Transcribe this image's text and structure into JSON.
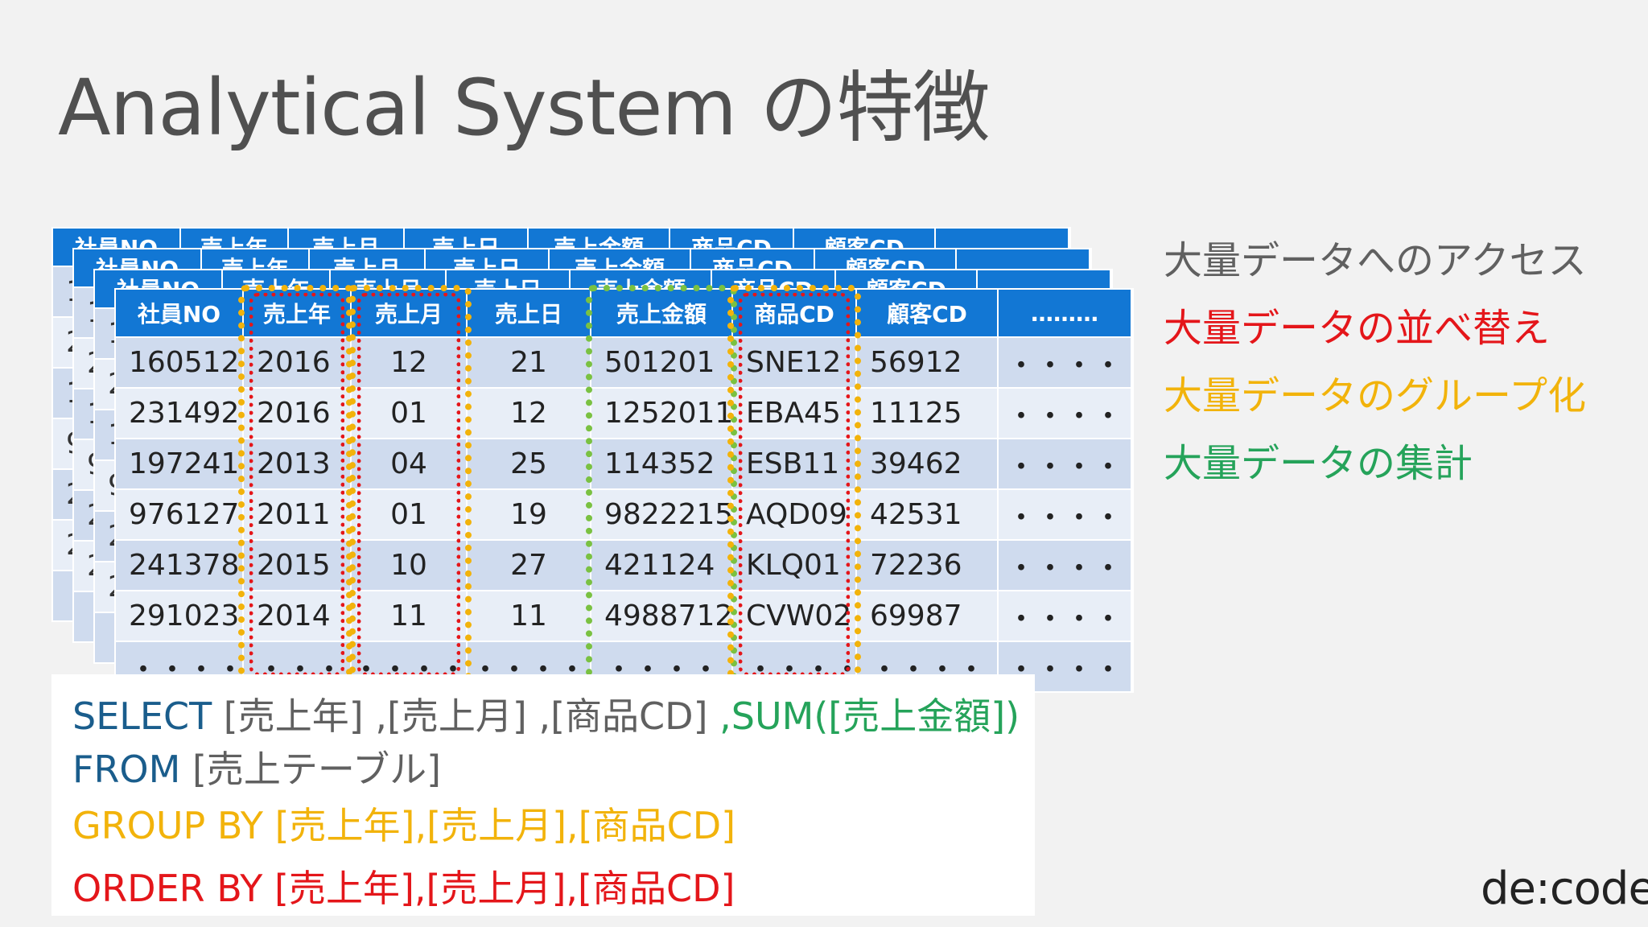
{
  "title": "Analytical System の特徴",
  "table": {
    "headers": [
      "社員NO",
      "売上年",
      "売上月",
      "売上日",
      "売上金額",
      "商品CD",
      "顧客CD",
      "………"
    ],
    "rows": [
      [
        "160512",
        "2016",
        "12",
        "21",
        "501201",
        "SNE12",
        "56912",
        "・・・・"
      ],
      [
        "231492",
        "2016",
        "01",
        "12",
        "1252011",
        "EBA45",
        "11125",
        "・・・・"
      ],
      [
        "197241",
        "2013",
        "04",
        "25",
        "114352",
        "ESB11",
        "39462",
        "・・・・"
      ],
      [
        "976127",
        "2011",
        "01",
        "19",
        "9822215",
        "AQD09",
        "42531",
        "・・・・"
      ],
      [
        "241378",
        "2015",
        "10",
        "27",
        "421124",
        "KLQ01",
        "72236",
        "・・・・"
      ],
      [
        "291023",
        "2014",
        "11",
        "11",
        "4988712",
        "CVW02",
        "69987",
        "・・・・"
      ],
      [
        "・・・・・・",
        "・・・・",
        "・・・・",
        "・・・・",
        "・・・・",
        "・・・・・",
        "・・・・・",
        "・・・・"
      ]
    ],
    "back_first_col": [
      "1",
      "2",
      "1",
      "9",
      "2",
      "2",
      "・"
    ]
  },
  "sql": {
    "select_kw": "SELECT",
    "select_cols": " [売上年] ,[売上月] ,[商品CD]",
    "sum_part": " ,SUM([売上金額])",
    "from_kw": "FROM",
    "from_table": " [売上テーブル]",
    "group_by": "GROUP BY [売上年],[売上月],[商品CD]",
    "order_by": "ORDER BY [売上年],[売上月],[商品CD]"
  },
  "features": [
    {
      "text": "大量データへのアクセス",
      "color": "#606060"
    },
    {
      "text": "大量データの並べ替え",
      "color": "#e4161a"
    },
    {
      "text": "大量データのグループ化",
      "color": "#f2b30b"
    },
    {
      "text": "大量データの集計",
      "color": "#25a35a"
    }
  ],
  "logo": "de:code"
}
